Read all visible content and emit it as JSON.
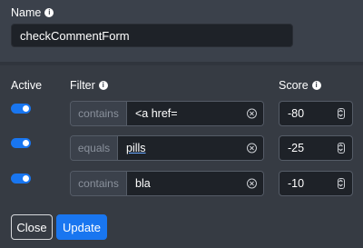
{
  "name": {
    "label": "Name",
    "info_icon": "info-icon",
    "value": "checkCommentForm"
  },
  "columns": {
    "active": "Active",
    "filter": "Filter",
    "score": "Score"
  },
  "rules": [
    {
      "active": true,
      "operator": "contains",
      "value": "<a href=",
      "score": "-80"
    },
    {
      "active": true,
      "operator": "equals",
      "value": "pills",
      "score": "-25"
    },
    {
      "active": true,
      "operator": "contains",
      "value": "bla",
      "score": "-10"
    }
  ],
  "buttons": {
    "close": "Close",
    "update": "Update"
  },
  "colors": {
    "accent": "#1976f0",
    "background": "#3b414b",
    "input_background": "#1e2228"
  }
}
